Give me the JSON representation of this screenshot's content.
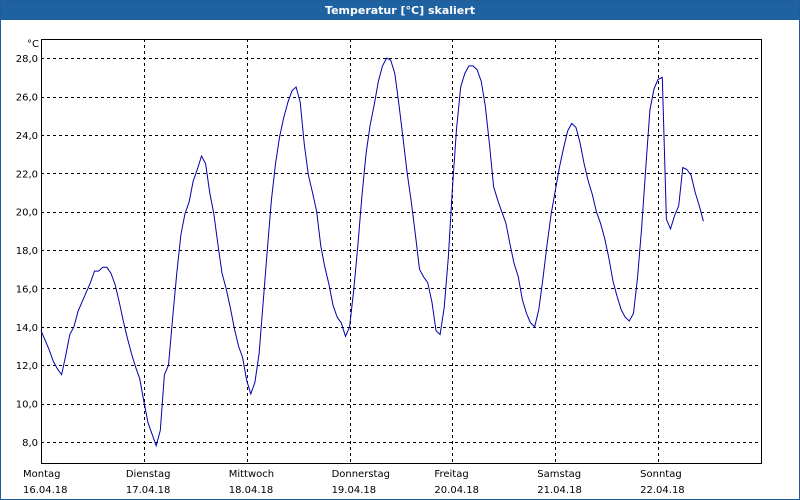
{
  "window": {
    "title": "Temperatur [°C] skaliert"
  },
  "chart_data": {
    "type": "line",
    "title": "Temperatur [°C] skaliert",
    "ylabel": "°C",
    "xlim": [
      0,
      7
    ],
    "ylim": [
      6.9,
      29.0
    ],
    "grid": true,
    "y_ticks": [
      "8,0",
      "10,0",
      "12,0",
      "14,0",
      "16,0",
      "18,0",
      "20,0",
      "22,0",
      "24,0",
      "26,0",
      "28,0"
    ],
    "y_tick_values": [
      8,
      10,
      12,
      14,
      16,
      18,
      20,
      22,
      24,
      26,
      28
    ],
    "x_ticks": [
      {
        "day": "Montag",
        "date": "16.04.18"
      },
      {
        "day": "Dienstag",
        "date": "17.04.18"
      },
      {
        "day": "Mittwoch",
        "date": "18.04.18"
      },
      {
        "day": "Donnerstag",
        "date": "19.04.18"
      },
      {
        "day": "Freitag",
        "date": "20.04.18"
      },
      {
        "day": "Samstag",
        "date": "21.04.18"
      },
      {
        "day": "Sonntag",
        "date": "22.04.18"
      }
    ],
    "color": "#0000aa",
    "x": [
      0.0,
      0.04,
      0.08,
      0.12,
      0.16,
      0.2,
      0.24,
      0.28,
      0.32,
      0.36,
      0.4,
      0.44,
      0.48,
      0.52,
      0.56,
      0.6,
      0.64,
      0.68,
      0.72,
      0.76,
      0.8,
      0.84,
      0.88,
      0.92,
      0.96,
      1.0,
      1.04,
      1.08,
      1.12,
      1.16,
      1.2,
      1.24,
      1.28,
      1.32,
      1.36,
      1.4,
      1.44,
      1.48,
      1.52,
      1.56,
      1.6,
      1.64,
      1.68,
      1.72,
      1.76,
      1.8,
      1.84,
      1.88,
      1.92,
      1.96,
      2.0,
      2.04,
      2.08,
      2.12,
      2.16,
      2.2,
      2.24,
      2.28,
      2.32,
      2.36,
      2.4,
      2.44,
      2.48,
      2.52,
      2.56,
      2.6,
      2.64,
      2.68,
      2.72,
      2.76,
      2.8,
      2.84,
      2.88,
      2.92,
      2.96,
      3.0,
      3.04,
      3.08,
      3.12,
      3.16,
      3.2,
      3.24,
      3.28,
      3.32,
      3.36,
      3.4,
      3.44,
      3.48,
      3.52,
      3.56,
      3.6,
      3.64,
      3.68,
      3.72,
      3.76,
      3.8,
      3.84,
      3.88,
      3.92,
      3.96,
      4.0,
      4.04,
      4.08,
      4.12,
      4.16,
      4.2,
      4.24,
      4.28,
      4.32,
      4.36,
      4.4,
      4.44,
      4.48,
      4.52,
      4.56,
      4.6,
      4.64,
      4.68,
      4.72,
      4.76,
      4.8,
      4.84,
      4.88,
      4.92,
      4.96,
      5.0,
      5.04,
      5.08,
      5.12,
      5.16,
      5.2,
      5.24,
      5.28,
      5.32,
      5.36,
      5.4,
      5.44,
      5.48,
      5.52,
      5.56,
      5.6,
      5.64,
      5.68,
      5.72,
      5.76,
      5.8,
      5.84,
      5.88,
      5.92,
      5.96,
      6.0,
      6.04,
      6.08,
      6.12,
      6.16,
      6.2,
      6.24,
      6.28,
      6.32,
      6.36,
      6.4,
      6.44,
      6.48,
      6.52,
      6.56,
      6.6,
      6.64,
      6.68,
      6.72,
      6.76,
      6.8,
      6.84,
      6.88,
      6.92,
      6.96,
      7.0
    ],
    "y": [
      13.8,
      13.3,
      12.8,
      12.2,
      11.8,
      11.5,
      12.5,
      13.6,
      14.0,
      14.8,
      15.3,
      15.8,
      16.3,
      16.9,
      16.9,
      17.1,
      17.1,
      16.8,
      16.2,
      15.3,
      14.3,
      13.4,
      12.6,
      11.9,
      11.3,
      10.1,
      9.0,
      8.4,
      7.8,
      8.6,
      11.5,
      12.0,
      14.5,
      16.8,
      18.8,
      19.9,
      20.5,
      21.6,
      22.2,
      22.9,
      22.5,
      21.0,
      19.9,
      18.3,
      16.8,
      16.0,
      15.0,
      13.9,
      13.0,
      12.4,
      11.2,
      10.5,
      11.1,
      12.6,
      15.3,
      18.0,
      20.6,
      22.5,
      23.9,
      24.9,
      25.7,
      26.3,
      26.5,
      25.7,
      23.5,
      21.9,
      21.0,
      20.0,
      18.2,
      17.1,
      16.2,
      15.1,
      14.5,
      14.2,
      13.5,
      14.0,
      15.9,
      18.2,
      20.8,
      23.0,
      24.5,
      25.6,
      26.8,
      27.6,
      28.0,
      27.9,
      27.2,
      25.6,
      23.8,
      22.0,
      20.5,
      18.8,
      17.0,
      16.6,
      16.3,
      15.3,
      13.8,
      13.6,
      15.0,
      17.6,
      21.2,
      24.3,
      26.5,
      27.2,
      27.6,
      27.6,
      27.4,
      26.8,
      25.5,
      23.5,
      21.3,
      20.6,
      20.0,
      19.4,
      18.3,
      17.3,
      16.6,
      15.4,
      14.7,
      14.2,
      14.0,
      14.9,
      16.5,
      18.3,
      19.9,
      21.1,
      22.3,
      23.3,
      24.2,
      24.6,
      24.4,
      23.6,
      22.5,
      21.6,
      20.9,
      20.0,
      19.4,
      18.6,
      17.6,
      16.4,
      15.6,
      14.9,
      14.5,
      14.3,
      14.7,
      16.6,
      19.2,
      22.3,
      25.3,
      26.4,
      26.9,
      27.0,
      19.6,
      19.1,
      19.8,
      20.3,
      22.3,
      22.2,
      21.9,
      21.0,
      20.3,
      19.5
    ]
  }
}
